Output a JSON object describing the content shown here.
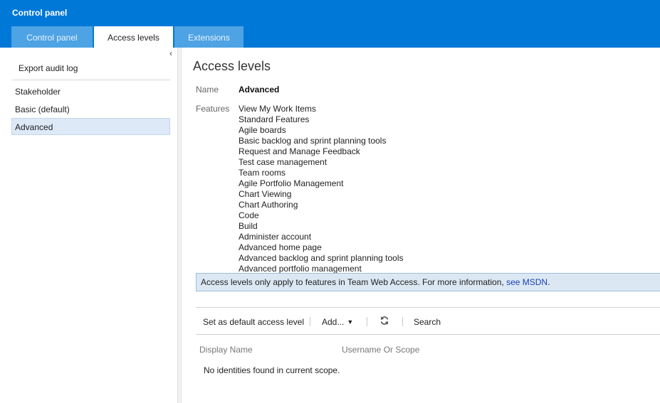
{
  "app": {
    "title": "Control panel"
  },
  "tabs": [
    {
      "label": "Control panel",
      "active": false
    },
    {
      "label": "Access levels",
      "active": true
    },
    {
      "label": "Extensions",
      "active": false
    }
  ],
  "sidebar": {
    "collapse_icon": "chevron-left-icon",
    "export_label": "Export audit log",
    "items": [
      {
        "label": "Stakeholder",
        "selected": false
      },
      {
        "label": "Basic (default)",
        "selected": false
      },
      {
        "label": "Advanced",
        "selected": true
      }
    ]
  },
  "main": {
    "title": "Access levels",
    "name_label": "Name",
    "name_value": "Advanced",
    "features_label": "Features",
    "features": [
      "View My Work Items",
      "Standard Features",
      "Agile boards",
      "Basic backlog and sprint planning tools",
      "Request and Manage Feedback",
      "Test case management",
      "Team rooms",
      "Agile Portfolio Management",
      "Chart Viewing",
      "Chart Authoring",
      "Code",
      "Build",
      "Administer account",
      "Advanced home page",
      "Advanced backlog and sprint planning tools",
      "Advanced portfolio management"
    ],
    "info_text": "Access levels only apply to features in Team Web Access. For more information, ",
    "info_link": "see MSDN",
    "info_end": "."
  },
  "toolbar": {
    "set_default_label": "Set as default access level",
    "add_label": "Add...",
    "refresh_icon": "refresh-icon",
    "search_label": "Search"
  },
  "table": {
    "columns": [
      "Display Name",
      "Username Or Scope"
    ],
    "empty_message": "No identities found in current scope."
  },
  "colors": {
    "header_blue": "#0078d7",
    "inactive_tab": "#4ea3e4",
    "selected_item": "#dde9f7",
    "info_bar": "#dbe8f4",
    "link": "#1a3fb5"
  }
}
